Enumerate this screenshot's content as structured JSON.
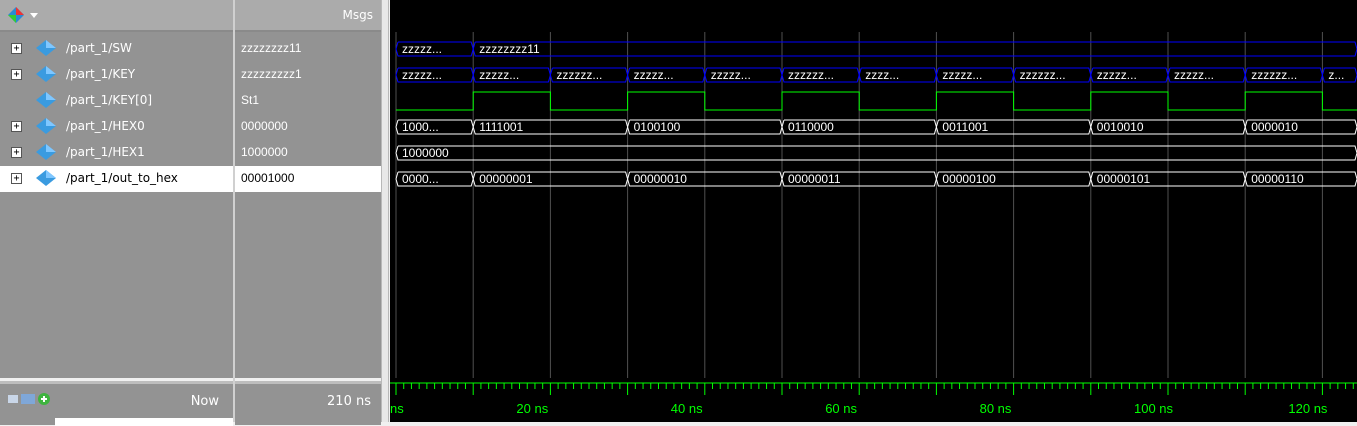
{
  "header": {
    "msgs_label": "Msgs"
  },
  "signals": [
    {
      "name": "/part_1/SW",
      "value": "zzzzzzzz11",
      "expandable": true,
      "icon": "signal-bus-icon"
    },
    {
      "name": "/part_1/KEY",
      "value": "zzzzzzzzz1",
      "expandable": true,
      "icon": "signal-bus-icon"
    },
    {
      "name": "/part_1/KEY[0]",
      "value": "St1",
      "expandable": false,
      "icon": "signal-bit-icon"
    },
    {
      "name": "/part_1/HEX0",
      "value": "0000000",
      "expandable": true,
      "icon": "signal-bus-icon"
    },
    {
      "name": "/part_1/HEX1",
      "value": "1000000",
      "expandable": true,
      "icon": "signal-bus-icon"
    },
    {
      "name": "/part_1/out_to_hex",
      "value": "00001000",
      "expandable": true,
      "icon": "signal-bus-icon",
      "selected": true
    }
  ],
  "footer": {
    "now_label": "Now",
    "now_value": "210 ns"
  },
  "waveforms": {
    "time_unit": "ns",
    "visible_start_ns": 0,
    "visible_end_ns": 125,
    "ruler_labels": [
      "ns",
      "20 ns",
      "40 ns",
      "60 ns",
      "80 ns",
      "100 ns",
      "120 ns"
    ],
    "sw": [
      {
        "start": 0,
        "end": 10,
        "label": "zzzzz..."
      },
      {
        "start": 10,
        "end": 125,
        "label": "zzzzzzzz11"
      }
    ],
    "key": [
      {
        "start": 0,
        "end": 10,
        "label": "zzzzz..."
      },
      {
        "start": 10,
        "end": 20,
        "label": "zzzzz..."
      },
      {
        "start": 20,
        "end": 30,
        "label": "zzzzzz..."
      },
      {
        "start": 30,
        "end": 40,
        "label": "zzzzz..."
      },
      {
        "start": 40,
        "end": 50,
        "label": "zzzzz..."
      },
      {
        "start": 50,
        "end": 60,
        "label": "zzzzzz..."
      },
      {
        "start": 60,
        "end": 70,
        "label": "zzzz..."
      },
      {
        "start": 70,
        "end": 80,
        "label": "zzzzz..."
      },
      {
        "start": 80,
        "end": 90,
        "label": "zzzzzz..."
      },
      {
        "start": 90,
        "end": 100,
        "label": "zzzzz..."
      },
      {
        "start": 100,
        "end": 110,
        "label": "zzzzz..."
      },
      {
        "start": 110,
        "end": 120,
        "label": "zzzzzz..."
      },
      {
        "start": 120,
        "end": 125,
        "label": "z..."
      }
    ],
    "key0_levels": [
      {
        "start": 0,
        "end": 10,
        "level": 0
      },
      {
        "start": 10,
        "end": 20,
        "level": 1
      },
      {
        "start": 20,
        "end": 30,
        "level": 0
      },
      {
        "start": 30,
        "end": 40,
        "level": 1
      },
      {
        "start": 40,
        "end": 50,
        "level": 0
      },
      {
        "start": 50,
        "end": 60,
        "level": 1
      },
      {
        "start": 60,
        "end": 70,
        "level": 0
      },
      {
        "start": 70,
        "end": 80,
        "level": 1
      },
      {
        "start": 80,
        "end": 90,
        "level": 0
      },
      {
        "start": 90,
        "end": 100,
        "level": 1
      },
      {
        "start": 100,
        "end": 110,
        "level": 0
      },
      {
        "start": 110,
        "end": 120,
        "level": 1
      },
      {
        "start": 120,
        "end": 125,
        "level": 0
      }
    ],
    "hex0": [
      {
        "start": 0,
        "end": 10,
        "label": "1000..."
      },
      {
        "start": 10,
        "end": 30,
        "label": "1111001"
      },
      {
        "start": 30,
        "end": 50,
        "label": "0100100"
      },
      {
        "start": 50,
        "end": 70,
        "label": "0110000"
      },
      {
        "start": 70,
        "end": 90,
        "label": "0011001"
      },
      {
        "start": 90,
        "end": 110,
        "label": "0010010"
      },
      {
        "start": 110,
        "end": 125,
        "label": "0000010"
      }
    ],
    "hex1": [
      {
        "start": 0,
        "end": 125,
        "label": "1000000"
      }
    ],
    "out_to_hex": [
      {
        "start": 0,
        "end": 10,
        "label": "0000..."
      },
      {
        "start": 10,
        "end": 30,
        "label": "00000001"
      },
      {
        "start": 30,
        "end": 50,
        "label": "00000010"
      },
      {
        "start": 50,
        "end": 70,
        "label": "00000011"
      },
      {
        "start": 70,
        "end": 90,
        "label": "00000100"
      },
      {
        "start": 90,
        "end": 110,
        "label": "00000101"
      },
      {
        "start": 110,
        "end": 125,
        "label": "00000110"
      }
    ],
    "colors": {
      "bus_normal": "#ffffff",
      "bus_z": "#0000ff",
      "bit": "#00ff00",
      "text": "#ffffff",
      "ruler": "#00ff00",
      "grid": "#505050"
    }
  }
}
